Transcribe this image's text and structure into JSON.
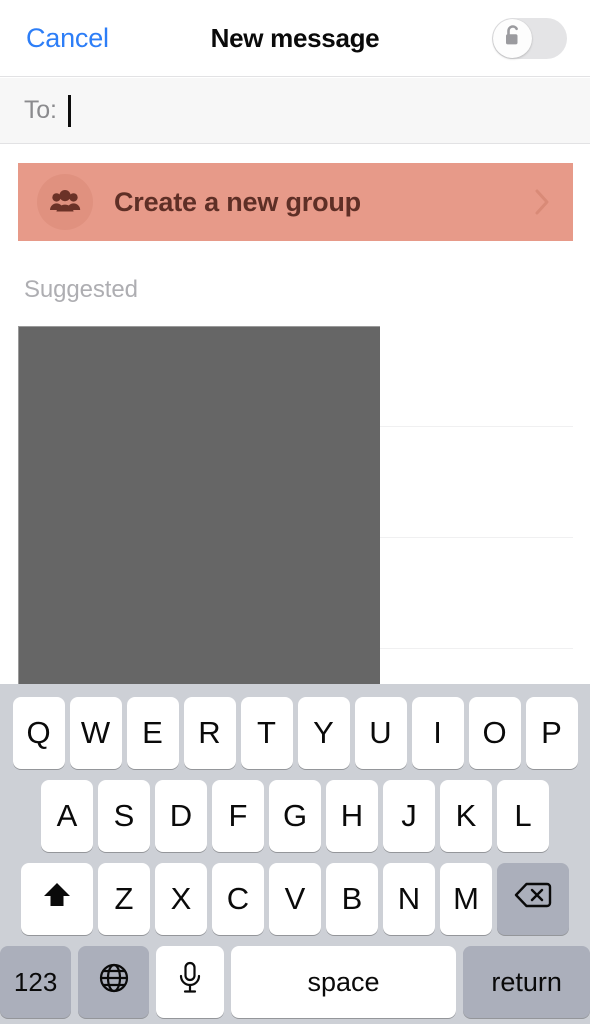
{
  "navbar": {
    "cancel_label": "Cancel",
    "title": "New message",
    "lock_toggle": {
      "icon": "unlocked-padlock-icon",
      "state": "off",
      "track_color": "#e4e4e6",
      "knob_color": "#fdfdfd"
    }
  },
  "recipient_field": {
    "label": "To:",
    "value": "",
    "placeholder": "",
    "caret_visible": true,
    "background_color": "#f7f7f7"
  },
  "create_group": {
    "label": "Create a new group",
    "icon": "group-people-icon",
    "chevron": "chevron-right-icon",
    "background_color": "#e79a89",
    "text_color": "#5e2f26",
    "avatar_color": "#e0917f"
  },
  "suggested": {
    "section_label": "Suggested",
    "contacts": [],
    "redacted": true,
    "redaction_color": "#666666",
    "separator_color": "#f0f0f1"
  },
  "keyboard": {
    "type": "ios-qwerty",
    "background_color": "#cdd0d6",
    "key_color": "#ffffff",
    "modifier_key_color": "#abafbb",
    "shift_state": "on",
    "rows": [
      {
        "name": "row-1",
        "keys": [
          "Q",
          "W",
          "E",
          "R",
          "T",
          "Y",
          "U",
          "I",
          "O",
          "P"
        ]
      },
      {
        "name": "row-2",
        "keys": [
          "A",
          "S",
          "D",
          "F",
          "G",
          "H",
          "J",
          "K",
          "L"
        ]
      },
      {
        "name": "row-3",
        "keys": [
          "Z",
          "X",
          "C",
          "V",
          "B",
          "N",
          "M"
        ]
      }
    ],
    "shift_key": {
      "label": "",
      "icon": "shift-arrow-up-icon",
      "active": true
    },
    "backspace_key": {
      "label": "",
      "icon": "delete-left-icon"
    },
    "numbers_key": {
      "label": "123"
    },
    "globe_key": {
      "label": "",
      "icon": "globe-icon"
    },
    "mic_key": {
      "label": "",
      "icon": "microphone-icon"
    },
    "space_key": {
      "label": "space"
    },
    "return_key": {
      "label": "return"
    }
  },
  "colors": {
    "accent_blue": "#2d7ef7",
    "title_black": "#0a0a0a",
    "muted_gray": "#8b8b8e",
    "suggested_gray": "#aeaeb2"
  }
}
